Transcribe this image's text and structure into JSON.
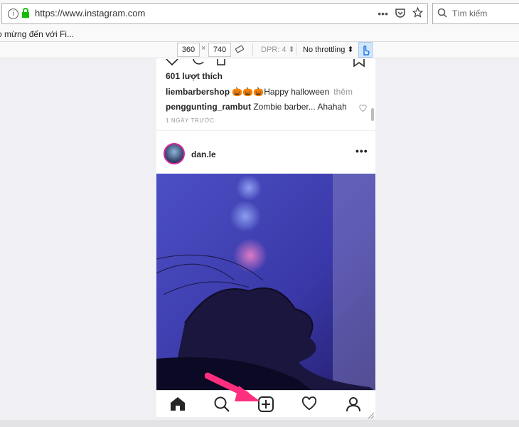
{
  "browser": {
    "url": "https://www.instagram.com",
    "search_placeholder": "Tìm kiếm",
    "bookmark": "o mừng đến với Fi..."
  },
  "rdm": {
    "width": "360",
    "height": "740",
    "times": "×",
    "dpr": "DPR: 4 ⬍",
    "throttle": "No throttling ⬍"
  },
  "feed": {
    "likes": "601 lượt thích",
    "caption_user": "liembarbershop",
    "caption_text": "🎃🎃🎃Happy halloween",
    "caption_more": "thêm",
    "comment_user": "penggunting_rambut",
    "comment_text": "Zombie barber... Ahahah",
    "timestamp": "1 NGÀY TRƯỚC",
    "post_username": "dan.le",
    "more": "•••"
  },
  "colors": {
    "accent": "#ff2e7e",
    "avatar_ring": "#d6249f",
    "touch_active": "#d2e6fb"
  }
}
